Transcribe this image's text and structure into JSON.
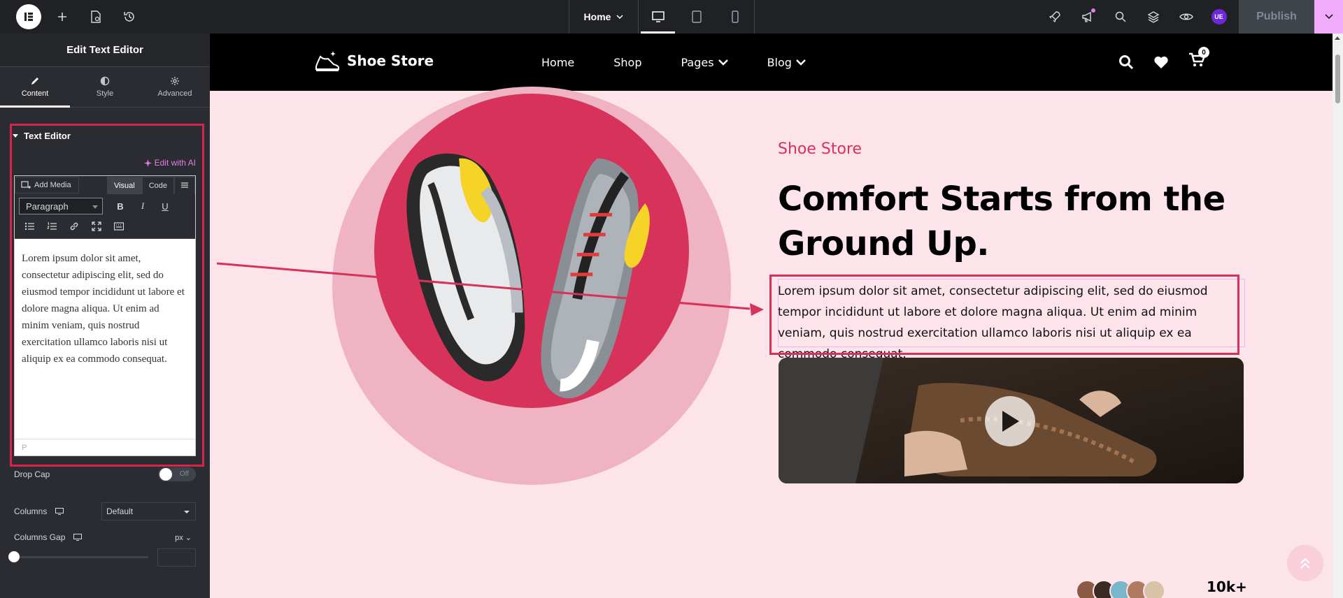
{
  "topbar": {
    "page_select": "Home",
    "publish_label": "Publish",
    "user_initials": "UE",
    "devices": [
      "desktop-icon",
      "tablet-icon",
      "mobile-icon"
    ]
  },
  "panel": {
    "title": "Edit Text Editor",
    "tabs": [
      {
        "label": "Content",
        "icon": "pencil-icon"
      },
      {
        "label": "Style",
        "icon": "contrast-icon"
      },
      {
        "label": "Advanced",
        "icon": "gear-icon"
      }
    ],
    "section_title": "Text Editor",
    "edit_ai_label": "Edit with AI",
    "add_media_label": "Add Media",
    "mode_visual": "Visual",
    "mode_code": "Code",
    "format_select": "Paragraph",
    "editor_text": "Lorem ipsum dolor sit amet, consectetur adipiscing elit, sed do eiusmod tempor incididunt ut labore et dolore magna aliqua. Ut enim ad minim veniam, quis nostrud exercitation ullamco laboris nisi ut aliquip ex ea commodo consequat.",
    "editor_status": "P",
    "drop_cap_label": "Drop Cap",
    "drop_cap_value": "Off",
    "columns_label": "Columns",
    "columns_value": "Default",
    "columns_gap_label": "Columns Gap",
    "columns_gap_unit": "px"
  },
  "site": {
    "brand": "Shoe Store",
    "nav": [
      {
        "label": "Home"
      },
      {
        "label": "Shop"
      },
      {
        "label": "Pages"
      },
      {
        "label": "Blog"
      }
    ],
    "cart_count": "0",
    "eyebrow": "Shoe Store",
    "headline": "Comfort Starts from the Ground Up.",
    "paragraph": "Lorem ipsum dolor sit amet, consectetur adipiscing elit, sed do eiusmod tempor incididunt ut labore et dolore magna aliqua. Ut enim ad minim veniam, quis nostrud exercitation ullamco laboris nisi ut aliquip ex ea commodo consequat.",
    "stats_number": "10k+"
  },
  "colors": {
    "accent": "#d6325a",
    "canvas_bg": "#fde4eb",
    "editor_dark": "#1f2124",
    "ai_pink": "#e37fe9"
  }
}
